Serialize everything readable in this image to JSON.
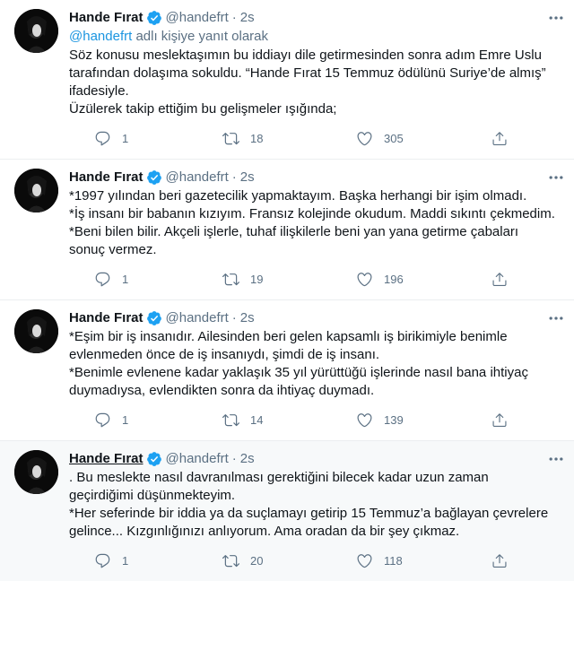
{
  "tweets": [
    {
      "author_name": "Hande Fırat",
      "handle": "@handefrt",
      "separator": "·",
      "time": "2s",
      "reply_prefix_handle": "@handefrt",
      "reply_suffix": " adlı kişiye yanıt olarak",
      "text": "Söz konusu meslektaşımın bu iddiayı dile getirmesinden sonra adım Emre Uslu tarafından dolaşıma sokuldu. “Hande Fırat 15 Temmuz ödülünü Suriye’de almış” ifadesiyle.\nÜzülerek takip ettiğim bu gelişmeler ışığında;",
      "replies": "1",
      "retweets": "18",
      "likes": "305"
    },
    {
      "author_name": "Hande Fırat",
      "handle": "@handefrt",
      "separator": "·",
      "time": "2s",
      "text": "*1997 yılından beri gazetecilik yapmaktayım. Başka herhangi bir işim olmadı.\n*İş insanı bir babanın kızıyım. Fransız kolejinde okudum. Maddi sıkıntı çekmedim.\n*Beni bilen bilir. Akçeli işlerle, tuhaf ilişkilerle beni yan yana getirme çabaları sonuç vermez.",
      "replies": "1",
      "retweets": "19",
      "likes": "196"
    },
    {
      "author_name": "Hande Fırat",
      "handle": "@handefrt",
      "separator": "·",
      "time": "2s",
      "text": "*Eşim bir iş insanıdır. Ailesinden beri gelen kapsamlı iş birikimiyle benimle evlenmeden önce de iş insanıydı, şimdi de iş insanı.\n*Benimle evlenene kadar yaklaşık 35 yıl yürüttüğü işlerinde nasıl bana ihtiyaç duymadıysa, evlendikten sonra da ihtiyaç duymadı.",
      "replies": "1",
      "retweets": "14",
      "likes": "139"
    },
    {
      "author_name": "Hande Fırat",
      "handle": "@handefrt",
      "separator": "·",
      "time": "2s",
      "text": ". Bu meslekte nasıl davranılması gerektiğini bilecek kadar uzun zaman geçirdiğimi düşünmekteyim.\n*Her seferinde bir iddia ya da suçlamayı getirip 15 Temmuz’a bağlayan çevrelere gelince... Kızgınlığınızı anlıyorum. Ama oradan da bir şey çıkmaz.",
      "replies": "1",
      "retweets": "20",
      "likes": "118"
    }
  ],
  "icons": {
    "verified": "verified-badge-icon",
    "more": "more-dots-icon",
    "reply": "reply-bubble-icon",
    "retweet": "retweet-arrows-icon",
    "like": "heart-icon",
    "share": "share-upload-icon"
  },
  "colors": {
    "accent": "#1da1f2",
    "link": "#1b95e0",
    "secondary_text": "#5b7083",
    "hover_bg": "#f7f9fa"
  }
}
